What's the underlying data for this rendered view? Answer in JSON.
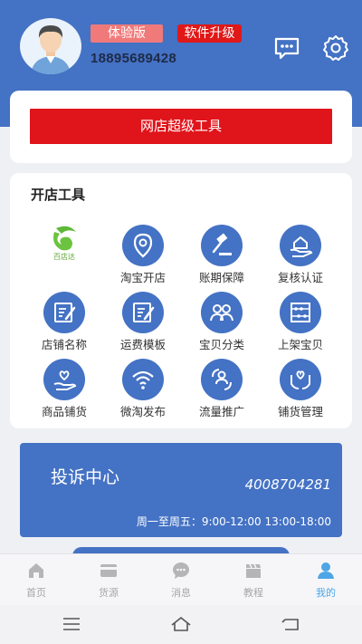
{
  "header": {
    "badge_trial": "体验版",
    "badge_upgrade": "软件升级",
    "phone": "18895689428",
    "colors": {
      "brand": "#4472c4",
      "trial_badge": "#f07a7a",
      "upgrade_badge": "#e01818"
    }
  },
  "banner": {
    "button_label": "网店超级工具",
    "color": "#e0141b"
  },
  "tools": {
    "title": "开店工具",
    "items": [
      {
        "label": "",
        "icon": "logo-icon",
        "logo_text": "百店达"
      },
      {
        "label": "淘宝开店",
        "icon": "location-pin-icon"
      },
      {
        "label": "账期保障",
        "icon": "gavel-icon"
      },
      {
        "label": "复核认证",
        "icon": "house-hand-icon"
      },
      {
        "label": "店铺名称",
        "icon": "edit-document-icon"
      },
      {
        "label": "运费模板",
        "icon": "edit-document-icon"
      },
      {
        "label": "宝贝分类",
        "icon": "people-icon"
      },
      {
        "label": "上架宝贝",
        "icon": "abacus-icon"
      },
      {
        "label": "商品铺货",
        "icon": "heart-hand-icon"
      },
      {
        "label": "微淘发布",
        "icon": "wifi-icon"
      },
      {
        "label": "流量推广",
        "icon": "exchange-people-icon"
      },
      {
        "label": "铺货管理",
        "icon": "hands-heart-icon"
      }
    ]
  },
  "complaint": {
    "title": "投诉中心",
    "phone": "4008704281",
    "hours": "周一至周五：9:00-12:00 13:00-18:00"
  },
  "tabbar": {
    "items": [
      {
        "label": "首页",
        "icon": "home-icon"
      },
      {
        "label": "货源",
        "icon": "card-icon"
      },
      {
        "label": "消息",
        "icon": "chat-icon"
      },
      {
        "label": "教程",
        "icon": "clapper-icon"
      },
      {
        "label": "我的",
        "icon": "person-icon"
      }
    ],
    "active_index": 4,
    "active_color": "#4da6e6"
  }
}
